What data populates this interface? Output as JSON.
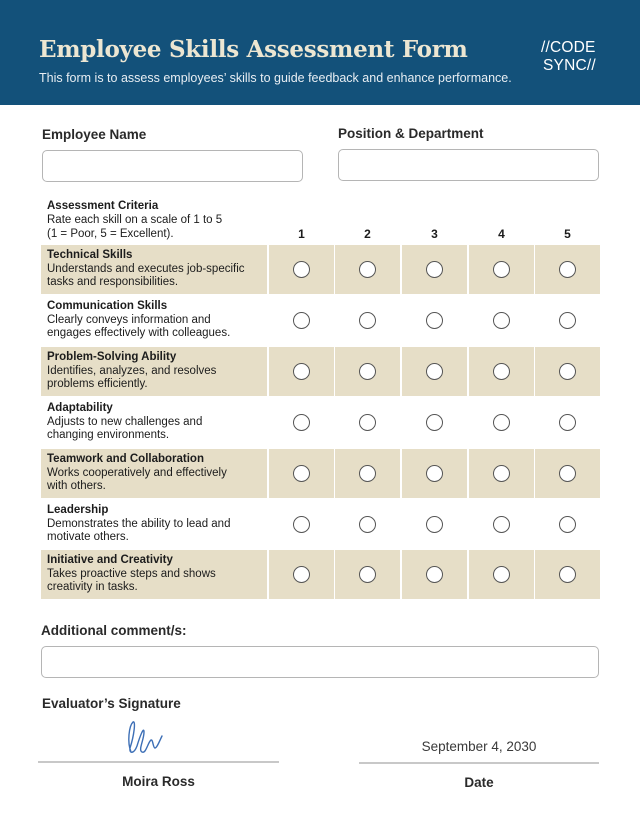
{
  "header": {
    "title": "Employee Skills Assessment Form",
    "subtitle": "This form is to assess employees’ skills to guide feedback and enhance performance.",
    "logo_line1": "//CODE",
    "logo_line2": "SYNC//",
    "background_color": "#13517a"
  },
  "fields": {
    "employee_name_label": "Employee Name",
    "employee_name_value": "",
    "position_label": "Position & Department",
    "position_value": ""
  },
  "assessment": {
    "heading": "Assessment Criteria",
    "instruction_line1": "Rate each skill on a scale of 1 to 5",
    "instruction_line2": "(1 = Poor, 5 = Excellent).",
    "scale": [
      "1",
      "2",
      "3",
      "4",
      "5"
    ],
    "shade_color": "#e6dec7",
    "criteria": [
      {
        "name": "Technical Skills",
        "desc_line1": "Understands and executes job-specific",
        "desc_line2": "tasks and responsibilities.",
        "selected": null
      },
      {
        "name": "Communication Skills",
        "desc_line1": "Clearly conveys information and",
        "desc_line2": "engages effectively with colleagues.",
        "selected": null
      },
      {
        "name": "Problem-Solving Ability",
        "desc_line1": "Identifies, analyzes, and resolves",
        "desc_line2": "problems efficiently.",
        "selected": null
      },
      {
        "name": "Adaptability",
        "desc_line1": "Adjusts to new challenges and",
        "desc_line2": "changing environments.",
        "selected": null
      },
      {
        "name": "Teamwork and Collaboration",
        "desc_line1": "Works cooperatively and effectively",
        "desc_line2": "with others.",
        "selected": null
      },
      {
        "name": "Leadership",
        "desc_line1": "Demonstrates the ability to lead and",
        "desc_line2": "motivate others.",
        "selected": null
      },
      {
        "name": "Initiative and Creativity",
        "desc_line1": "Takes proactive steps and shows",
        "desc_line2": "creativity in tasks.",
        "selected": null
      }
    ]
  },
  "comments": {
    "label": "Additional comment/s:",
    "value": ""
  },
  "signature": {
    "label": "Evaluator’s Signature",
    "evaluator_name": "Moira Ross",
    "date_value": "September 4, 2030",
    "date_label": "Date",
    "ink_color": "#3d6fb6"
  }
}
